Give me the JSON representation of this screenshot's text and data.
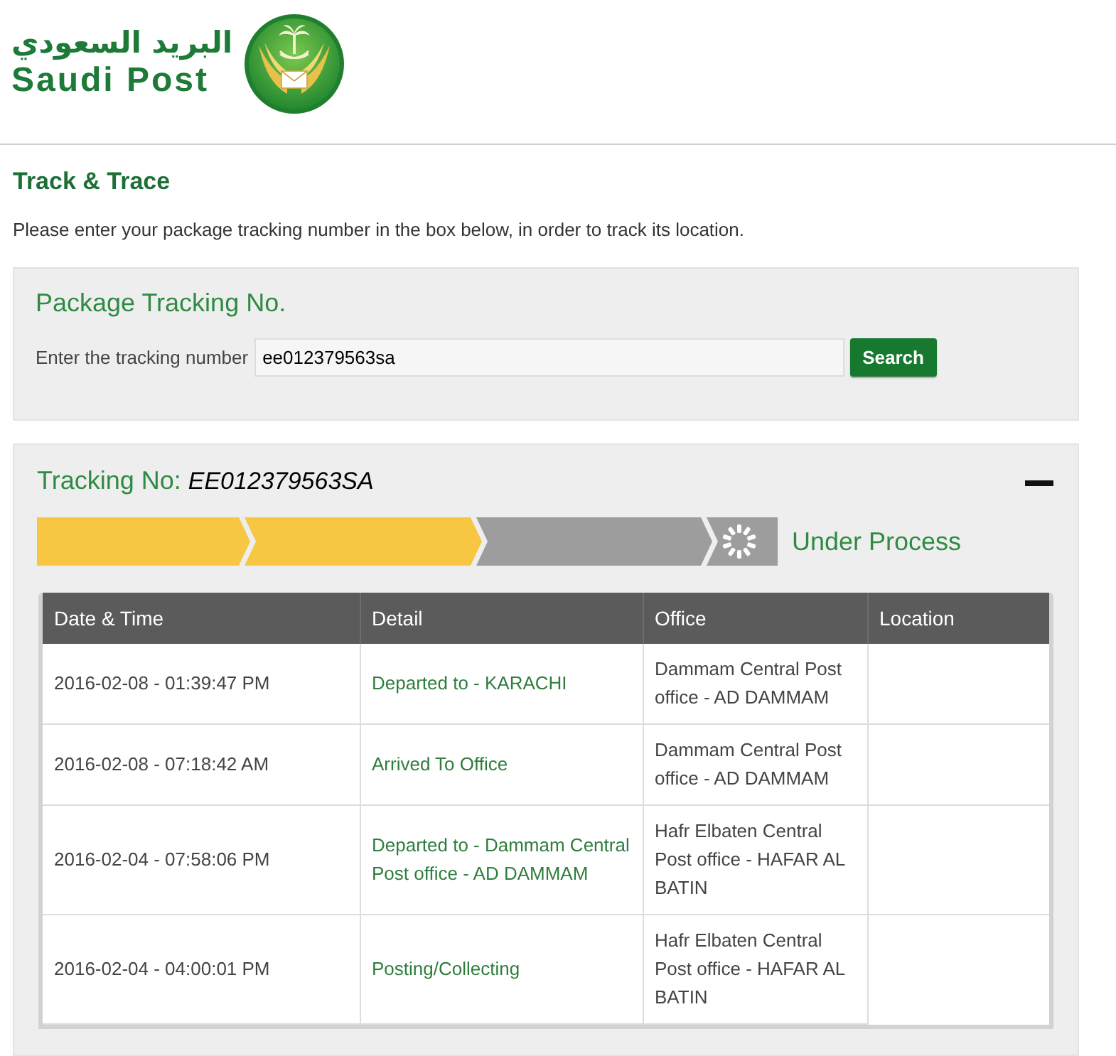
{
  "header": {
    "logo_arabic": "البريد السعودي",
    "logo_text": "Saudi Post"
  },
  "page": {
    "title": "Track & Trace",
    "description": "Please enter your package tracking number in the box below, in order to track its location."
  },
  "search_panel": {
    "title": "Package Tracking No.",
    "field_label": "Enter the tracking number",
    "field_value": "ee012379563sa",
    "button": "Search"
  },
  "result_panel": {
    "label": "Tracking No:",
    "number": "EE012379563SA",
    "expanded": true,
    "progress": {
      "steps": [
        {
          "done": true
        },
        {
          "done": true
        },
        {
          "done": false
        }
      ],
      "status": "Under Process"
    },
    "table": {
      "columns": [
        "Date & Time",
        "Detail",
        "Office",
        "Location"
      ],
      "rows": [
        {
          "date_time": "2016-02-08 - 01:39:47 PM",
          "detail": "Departed to - KARACHI",
          "office": "Dammam Central Post office - AD DAMMAM"
        },
        {
          "date_time": "2016-02-08 - 07:18:42 AM",
          "detail": "Arrived To Office",
          "office": "Dammam Central Post office - AD DAMMAM"
        },
        {
          "date_time": "2016-02-04 - 07:58:06 PM",
          "detail": "Departed to - Dammam Central Post office - AD DAMMAM",
          "office": "Hafr Elbaten Central Post office - HAFAR AL BATIN"
        },
        {
          "date_time": "2016-02-04 - 04:00:01 PM",
          "detail": "Posting/Collecting",
          "office": "Hafr Elbaten Central Post office - HAFAR AL BATIN"
        }
      ]
    }
  }
}
